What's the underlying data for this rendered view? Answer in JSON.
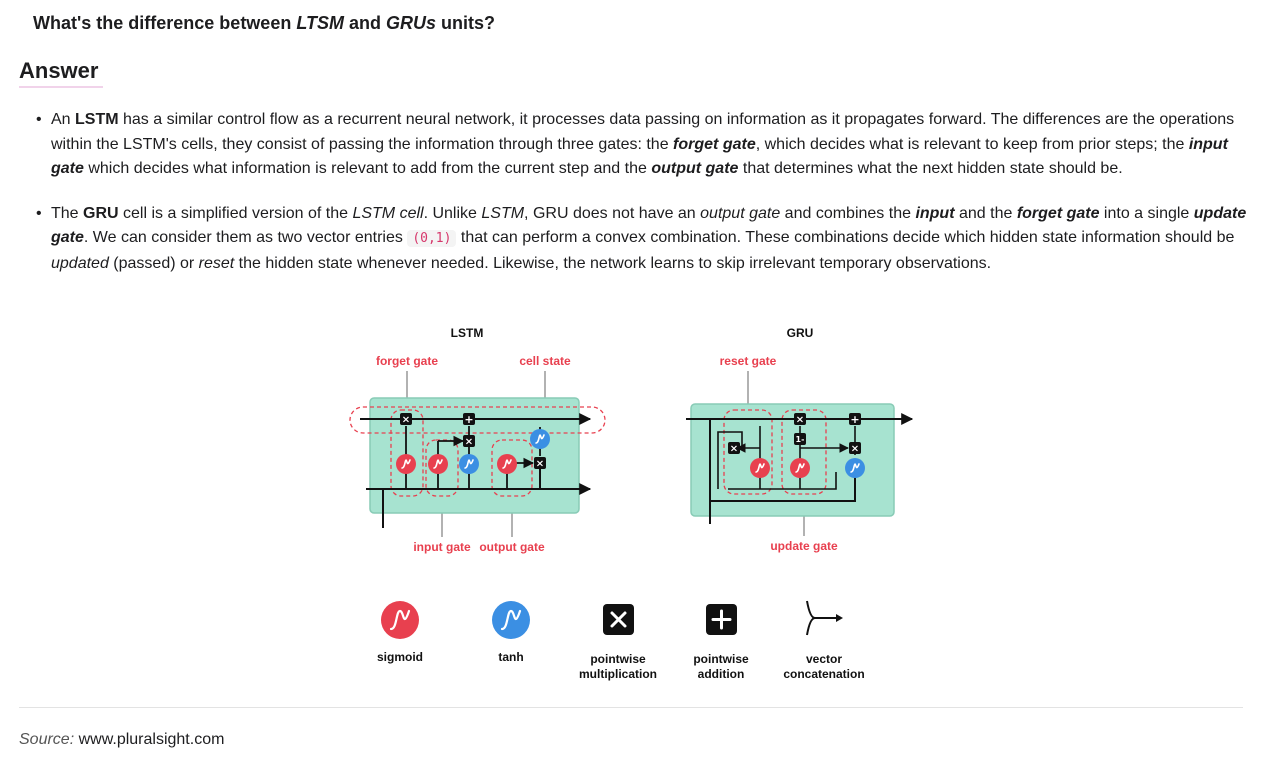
{
  "question": {
    "prefix": "What's the difference between ",
    "term1": "LTSM",
    "middle": " and ",
    "term2": "GRUs",
    "suffix": " units?"
  },
  "answer_heading": "Answer",
  "bullets": [
    {
      "parts": [
        "An ",
        "LSTM",
        " has a similar control flow as a recurrent neural network, it processes data passing on information as it propagates forward. The differences are the operations within the LSTM's cells, they consist of passing the information through three gates: the ",
        "forget gate",
        ", which decides what is relevant to keep from prior steps; the ",
        "input gate",
        " which decides what information is relevant to add from the current step and the ",
        "output gate",
        " that determines what the next hidden state should be."
      ]
    },
    {
      "parts": [
        "The ",
        "GRU",
        " cell is a simplified version of the ",
        "LSTM cell",
        ". Unlike ",
        "LSTM",
        ", GRU does not have an ",
        "output gate",
        " and combines the ",
        "input",
        " and the ",
        "forget gate",
        " into a single ",
        "update gate",
        ". We can consider them as two vector entries ",
        "(0,1)",
        " that can perform a convex combination. These combinations decide which hidden state information should be ",
        "updated",
        " (passed) or ",
        "reset",
        " the hidden state whenever needed. Likewise, the network learns to skip irrelevant temporary observations."
      ]
    }
  ],
  "diagram": {
    "lstm_title": "LSTM",
    "gru_title": "GRU",
    "lstm_labels": {
      "forget_gate": "forget gate",
      "cell_state": "cell state",
      "input_gate": "input gate",
      "output_gate": "output gate"
    },
    "gru_labels": {
      "reset_gate": "reset gate",
      "update_gate": "update gate"
    },
    "legend": {
      "sigmoid": "sigmoid",
      "tanh": "tanh",
      "mult_line1": "pointwise",
      "mult_line2": "multiplication",
      "add_line1": "pointwise",
      "add_line2": "addition",
      "concat_line1": "vector",
      "concat_line2": "concatenation"
    },
    "colors": {
      "cell_fill": "#a7e3d0",
      "cell_stroke": "#88cbb6",
      "sigmoid": "#e8404f",
      "tanh": "#3b8fe3",
      "label_red": "#e8404f",
      "line": "#111111"
    }
  },
  "source": {
    "label": "Source:",
    "value": " www.pluralsight.com"
  }
}
